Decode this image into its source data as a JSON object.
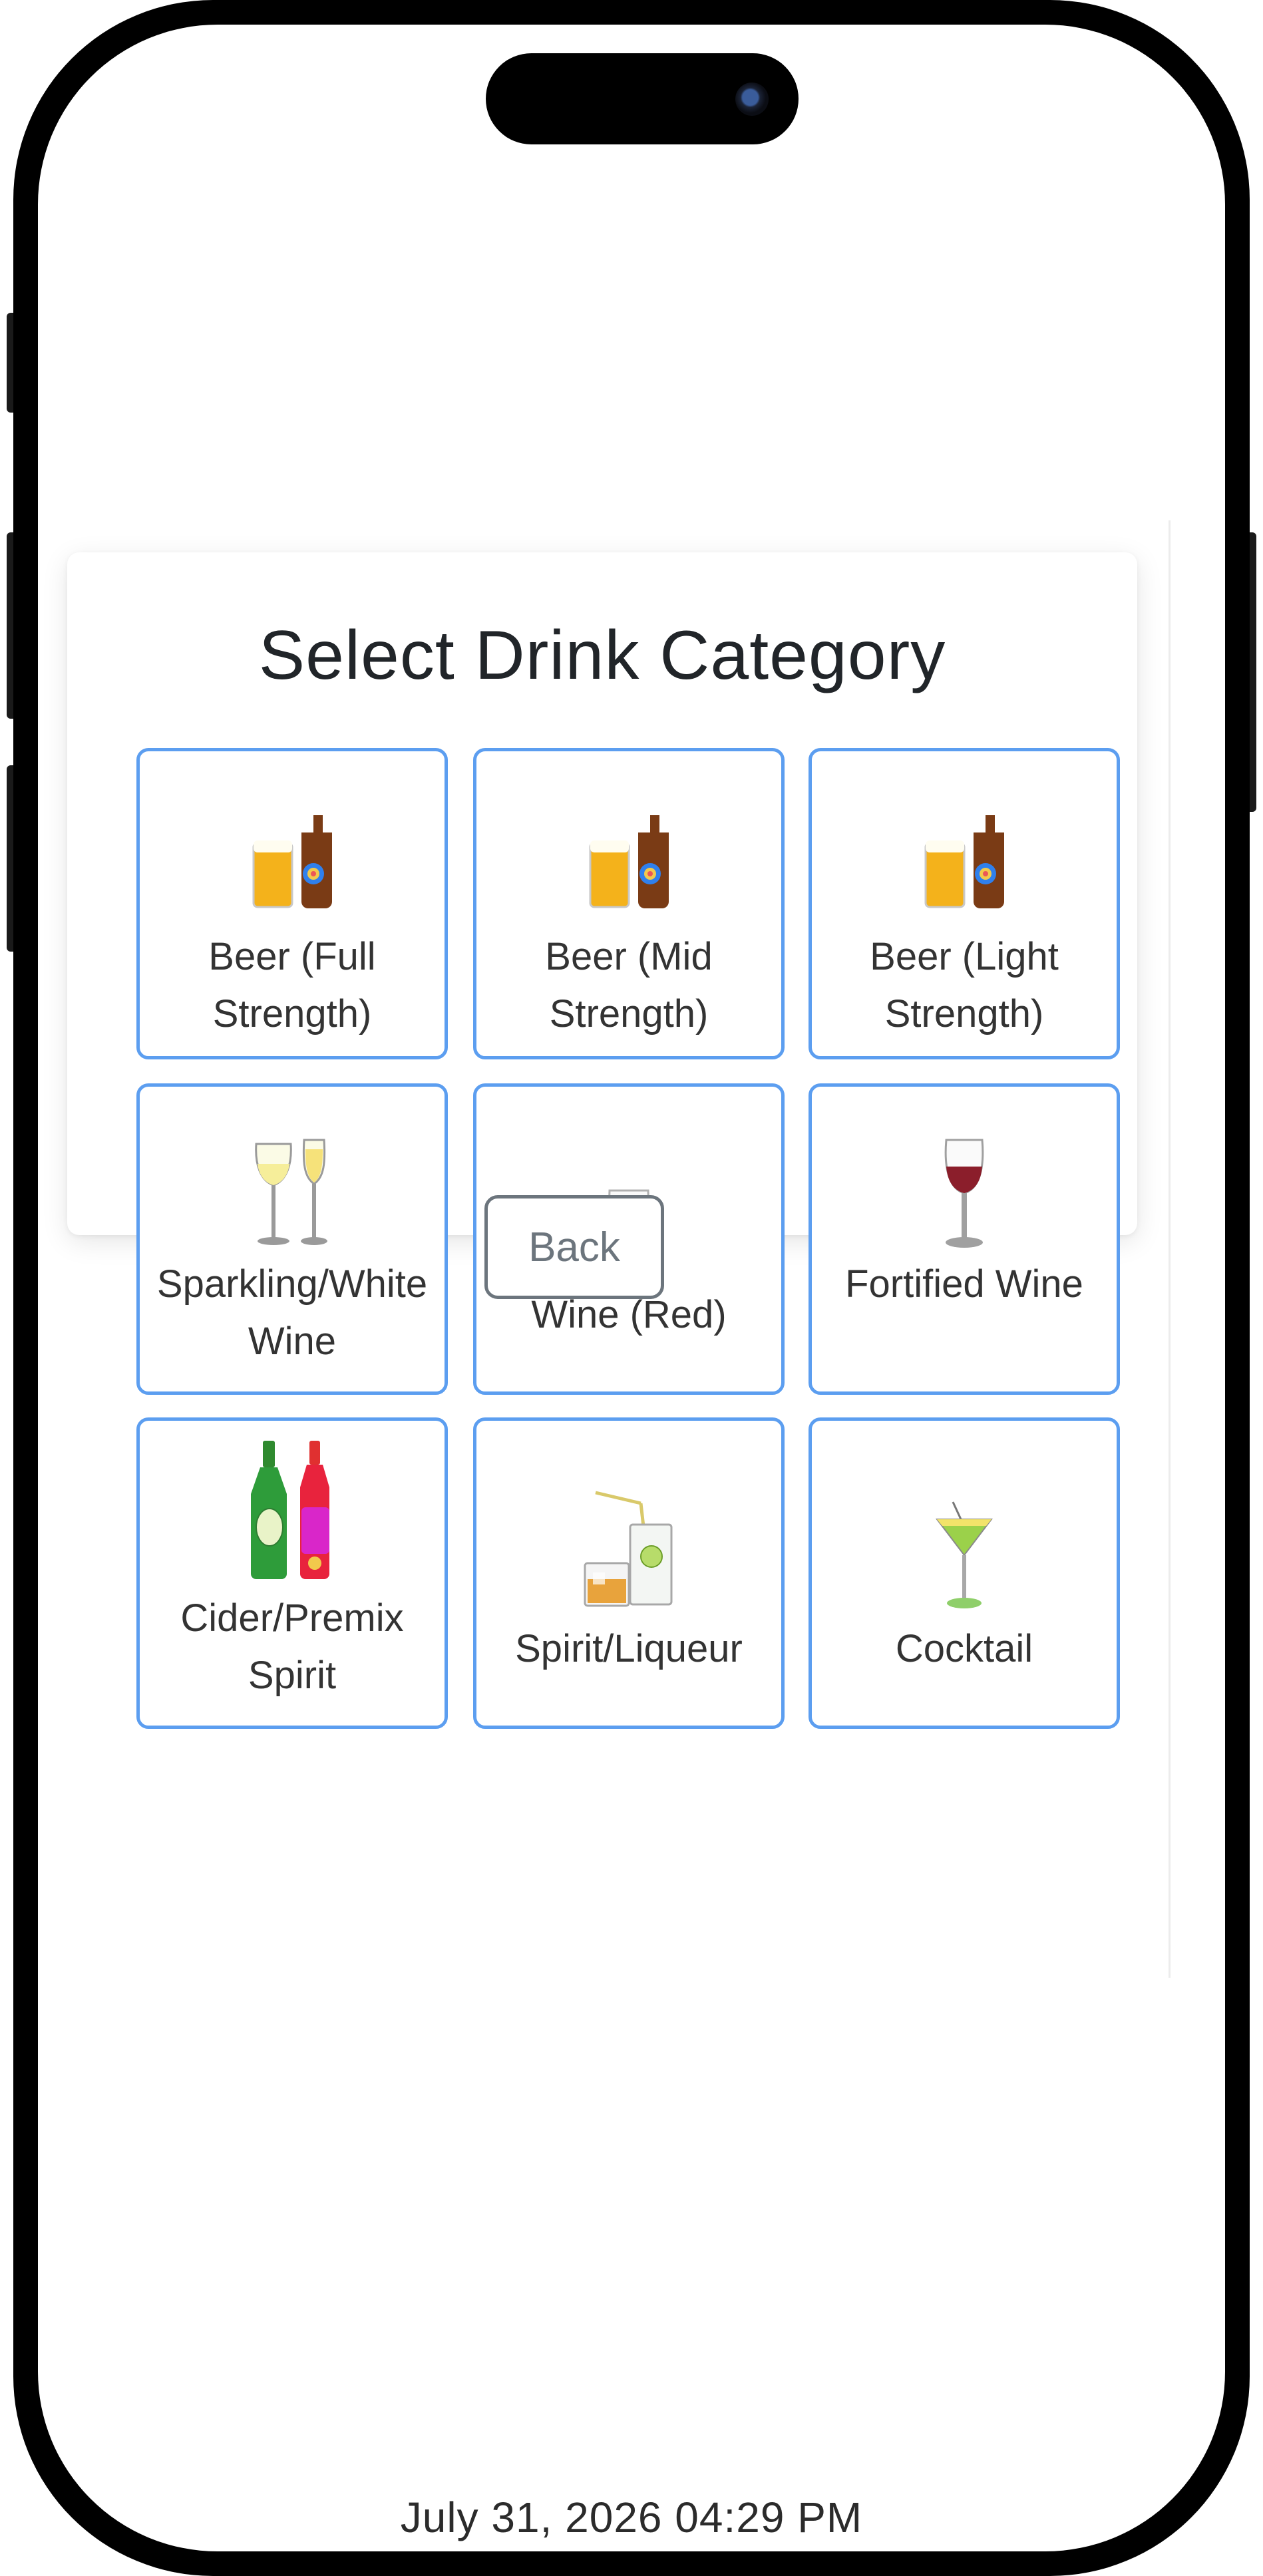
{
  "page": {
    "title": "Select Drink Category",
    "back_label": "Back",
    "datetime": "July 31, 2026 04:29 PM"
  },
  "categories": [
    {
      "label": "Beer (Full Strength)",
      "icon": "beer-icon"
    },
    {
      "label": "Beer (Mid Strength)",
      "icon": "beer-icon"
    },
    {
      "label": "Beer (Light Strength)",
      "icon": "beer-icon"
    },
    {
      "label": "Sparkling/White Wine",
      "icon": "sparkling-white-wine-icon"
    },
    {
      "label": "Wine (Red)",
      "icon": "red-wine-icon"
    },
    {
      "label": "Fortified Wine",
      "icon": "fortified-wine-icon"
    },
    {
      "label": "Cider/Premix Spirit",
      "icon": "cider-premix-icon"
    },
    {
      "label": "Spirit/Liqueur",
      "icon": "spirit-liqueur-icon"
    },
    {
      "label": "Cocktail",
      "icon": "cocktail-icon"
    }
  ],
  "colors": {
    "tile_border": "#5c9ef0",
    "back_border": "#6c757d",
    "title_text": "#212529"
  }
}
